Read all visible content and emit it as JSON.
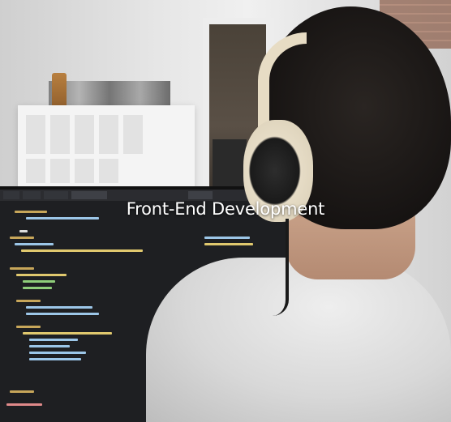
{
  "image": {
    "headline": "Front-End Development"
  },
  "colors": {
    "headline_text": "#ffffff",
    "screen_background": "#1e1f22",
    "headphone_cream": "#e7dcc4"
  }
}
